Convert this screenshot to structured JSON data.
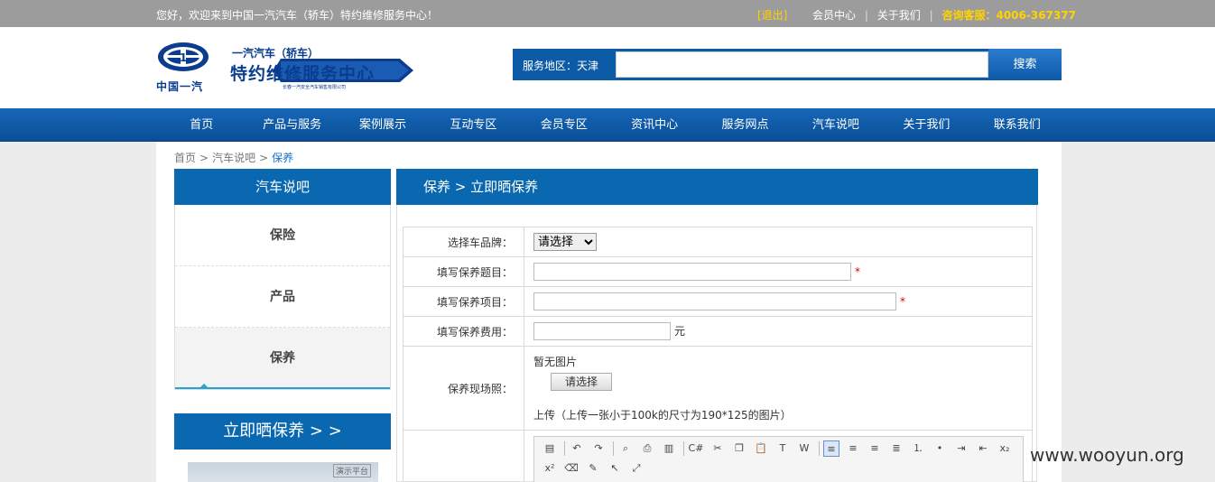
{
  "topbar": {
    "welcome": "您好，欢迎来到中国一汽汽车（轿车）特约维修服务中心！",
    "logout": "[退出]",
    "member": "会员中心",
    "divider": "|",
    "about": "关于我们",
    "hotline": "咨询客服：4006-367377"
  },
  "logo": {
    "emblem": "1",
    "brand": "中国一汽",
    "sub": "一汽汽车（轿车）",
    "title": "特约维修服务中心",
    "small": "长春一汽安全汽车销售有限公司"
  },
  "search": {
    "area": "服务地区：天津",
    "value": "",
    "button": "搜索"
  },
  "nav": [
    "首页",
    "产品与服务",
    "案例展示",
    "互动专区",
    "会员专区",
    "资讯中心",
    "服务网点",
    "汽车说吧",
    "关于我们",
    "联系我们"
  ],
  "breadcrumb": {
    "home": "首页",
    "sep": ">",
    "section": "汽车说吧",
    "current": "保养"
  },
  "sidebar": {
    "title": "汽车说吧",
    "items": [
      "保险",
      "产品",
      "保养"
    ],
    "active_index": 2,
    "cta": "立即晒保养 > >",
    "thumb_tag": "演示平台"
  },
  "main": {
    "title": "保养 > 立即晒保养"
  },
  "form": {
    "brand_label": "选择车品牌：",
    "brand_value": "请选择",
    "subject_label": "填写保养题目：",
    "subject_value": "",
    "item_label": "填写保养项目：",
    "item_value": "",
    "cost_label": "填写保养费用：",
    "cost_value": "",
    "cost_unit": "元",
    "required_mark": "*",
    "photo_label": "保养现场照：",
    "photo_none": "暂无图片",
    "photo_button": "请选择",
    "photo_hint": "上传（上传一张小于100k的尺寸为190*125的图片）"
  },
  "editor_toolbar": [
    {
      "name": "source-icon",
      "glyph": "▤"
    },
    {
      "name": "undo-icon",
      "glyph": "↶"
    },
    {
      "name": "redo-icon",
      "glyph": "↷"
    },
    {
      "name": "preview-icon",
      "glyph": "⌕"
    },
    {
      "name": "print-icon",
      "glyph": "⎙"
    },
    {
      "name": "template-icon",
      "glyph": "▥"
    },
    {
      "name": "code-icon",
      "glyph": "C#"
    },
    {
      "name": "cut-icon",
      "glyph": "✂"
    },
    {
      "name": "copy-icon",
      "glyph": "❐"
    },
    {
      "name": "paste-icon",
      "glyph": "📋"
    },
    {
      "name": "paste-text-icon",
      "glyph": "T"
    },
    {
      "name": "paste-word-icon",
      "glyph": "W"
    },
    {
      "name": "align-left-icon",
      "glyph": "≡"
    },
    {
      "name": "align-center-icon",
      "glyph": "≡"
    },
    {
      "name": "align-right-icon",
      "glyph": "≡"
    },
    {
      "name": "align-justify-icon",
      "glyph": "≣"
    },
    {
      "name": "ordered-list-icon",
      "glyph": "⒈"
    },
    {
      "name": "unordered-list-icon",
      "glyph": "•"
    },
    {
      "name": "indent-icon",
      "glyph": "⇥"
    },
    {
      "name": "outdent-icon",
      "glyph": "⇤"
    },
    {
      "name": "subscript-icon",
      "glyph": "x₂"
    },
    {
      "name": "superscript-icon",
      "glyph": "x²"
    },
    {
      "name": "clear-format-icon",
      "glyph": "⌫"
    },
    {
      "name": "select-all-icon",
      "glyph": "✎"
    },
    {
      "name": "cursor-icon",
      "glyph": "↖"
    },
    {
      "name": "fullscreen-icon",
      "glyph": "⤢"
    }
  ],
  "watermark": "www.wooyun.org"
}
